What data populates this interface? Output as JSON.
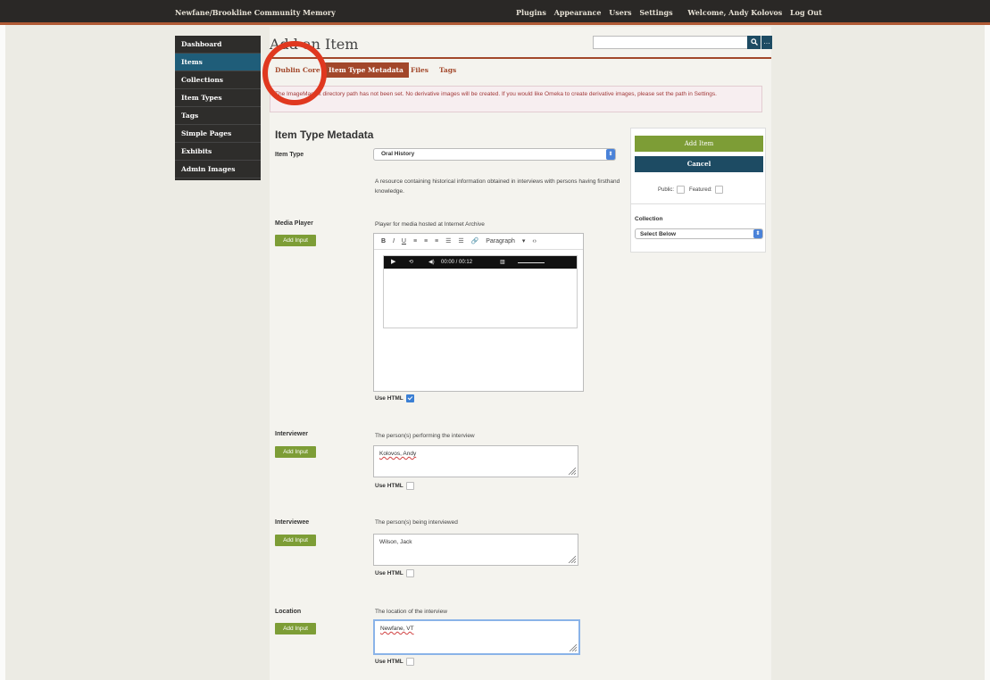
{
  "topbar": {
    "site_title": "Newfane/Brookline Community Memory",
    "nav": [
      "Plugins",
      "Appearance",
      "Users",
      "Settings"
    ],
    "welcome": "Welcome, Andy Kolovos",
    "logout": "Log Out"
  },
  "sidebar": {
    "items": [
      {
        "label": "Dashboard",
        "active": false
      },
      {
        "label": "Items",
        "active": true
      },
      {
        "label": "Collections",
        "active": false
      },
      {
        "label": "Item Types",
        "active": false
      },
      {
        "label": "Tags",
        "active": false
      },
      {
        "label": "Simple Pages",
        "active": false
      },
      {
        "label": "Exhibits",
        "active": false
      },
      {
        "label": "Admin Images",
        "active": false
      }
    ]
  },
  "header": {
    "page_title": "Add an Item",
    "search_placeholder": ""
  },
  "tabs": [
    "Dublin Core",
    "Item Type Metadata",
    "Files",
    "Tags"
  ],
  "flash": "The ImageMagick directory path has not been set. No derivative images will be created. If you would like Omeka to create derivative images, please set the path in Settings.",
  "form": {
    "section_title": "Item Type Metadata",
    "item_type": {
      "label": "Item Type",
      "value": "Oral History",
      "description": "A resource containing historical information obtained in interviews with persons having firsthand knowledge."
    },
    "add_input_label": "Add Input",
    "use_html_label": "Use HTML",
    "media_player": {
      "label": "Media Player",
      "description": "Player for media hosted at Internet Archive",
      "toolbar": [
        "B",
        "I",
        "U",
        "≡",
        "≡",
        "≡",
        "☰",
        "☰",
        "🔗",
        "Paragraph",
        "▾",
        "‹›"
      ],
      "player_time": "00:00 / 00:12",
      "use_html": true
    },
    "interviewer": {
      "label": "Interviewer",
      "description": "The person(s) performing the interview",
      "value": "Kolovos, Andy",
      "use_html": false
    },
    "interviewee": {
      "label": "Interviewee",
      "description": "The person(s) being interviewed",
      "value": "Wilson, Jack",
      "use_html": false
    },
    "location": {
      "label": "Location",
      "description": "The location of the interview",
      "value": "Newfane, VT",
      "use_html": false
    }
  },
  "panel": {
    "add_item": "Add Item",
    "cancel": "Cancel",
    "public_label": "Public:",
    "featured_label": "Featured:",
    "collection_label": "Collection",
    "collection_value": "Select Below"
  },
  "colors": {
    "topbar": "#2a2826",
    "accent": "#a2472a",
    "nav_active": "#1f5d79",
    "add_button": "#7d9d36",
    "cancel_button": "#1d4b63",
    "annotation": "#e0381f"
  }
}
